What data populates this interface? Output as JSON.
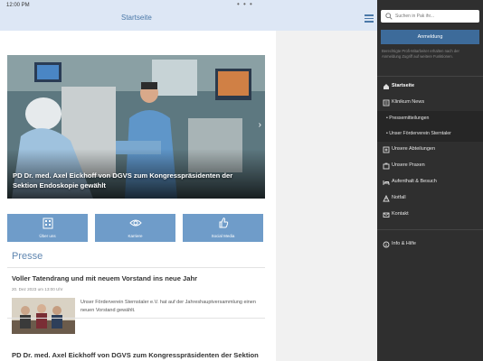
{
  "status": {
    "time": "12:00 PM",
    "dots": "• • •"
  },
  "header": {
    "title": "Startseite"
  },
  "slider": {
    "caption": "PD Dr. med. Axel Eickhoff von DGVS zum Kongresspräsidenten der Sektion Endoskopie gewählt",
    "next_arrow": "›",
    "pages": 3,
    "active_page": 1
  },
  "quick_links": [
    {
      "label": "Über uns",
      "icon": "building-icon"
    },
    {
      "label": "Karriere",
      "icon": "eye-icon"
    },
    {
      "label": "Social Media",
      "icon": "thumbs-up-icon"
    }
  ],
  "press": {
    "title": "Presse",
    "articles": [
      {
        "title": "Voller Tatendrang und mit neuem Vorstand ins neue Jahr",
        "date": "20. Dez 2023 um 13:00 Uhr",
        "text": "Unser Förderverein Sternstaler e.V. hat auf der Jahreshauptversammlung einen neuen Vorstand gewählt."
      },
      {
        "title": "PD Dr. med. Axel Eickhoff von DGVS zum Kongresspräsidenten der Sektion"
      }
    ]
  },
  "sidebar": {
    "search_placeholder": "Suchen in Pak ihr...",
    "login_label": "Anmeldung",
    "hint": "Berechtigte Profi-Mitarbeiter erhalten nach der Anmeldung Zugriff auf weitere Funktionen.",
    "nav": [
      {
        "label": "Startseite",
        "icon": "home-icon",
        "active": true
      },
      {
        "label": "Klinikum News",
        "icon": "news-icon"
      }
    ],
    "sub": [
      {
        "label": "• Pressemitteilungen"
      },
      {
        "label": "• Unser Förderverein Sterntaler"
      }
    ],
    "nav2": [
      {
        "label": "Unsere Abteilungen",
        "icon": "departments-icon"
      },
      {
        "label": "Unsere Praxen",
        "icon": "practice-icon"
      },
      {
        "label": "Aufenthalt & Besuch",
        "icon": "bed-icon"
      },
      {
        "label": "Notfall",
        "icon": "emergency-icon"
      },
      {
        "label": "Kontakt",
        "icon": "contact-icon"
      }
    ],
    "info": {
      "label": "Info & Hilfe",
      "icon": "info-icon"
    }
  },
  "colors": {
    "accent": "#4a78a8",
    "tile": "#6f9cc9",
    "sidebar": "#2f2f2f"
  }
}
